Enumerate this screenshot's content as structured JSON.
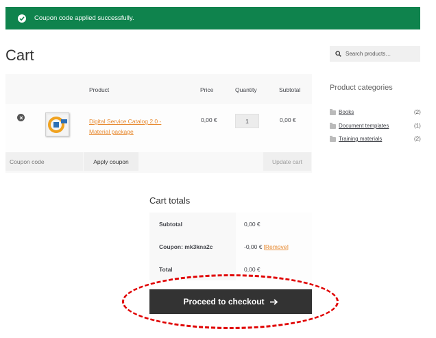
{
  "notice": {
    "message": "Coupon code applied successfully.",
    "icon": "check-icon",
    "color": "#0f834d"
  },
  "page": {
    "title": "Cart"
  },
  "cart": {
    "headers": {
      "product": "Product",
      "price": "Price",
      "quantity": "Quantity",
      "subtotal": "Subtotal"
    },
    "items": [
      {
        "name_line1": "Digital Service Catalog 2.0 -",
        "name_line2": "Material package",
        "price": "0,00 €",
        "quantity": "1",
        "subtotal": "0,00 €"
      }
    ],
    "coupon_placeholder": "Coupon code",
    "apply_label": "Apply coupon",
    "update_label": "Update cart"
  },
  "totals": {
    "title": "Cart totals",
    "subtotal_label": "Subtotal",
    "subtotal_value": "0,00 €",
    "coupon_label": "Coupon: mk3kna2c",
    "coupon_value": "-0,00 €",
    "coupon_remove": "[Remove]",
    "total_label": "Total",
    "total_value": "0,00 €",
    "checkout_label": "Proceed to checkout"
  },
  "sidebar": {
    "search_placeholder": "Search products…",
    "categories_title": "Product categories",
    "categories": [
      {
        "label": "Books",
        "count": "(2)"
      },
      {
        "label": "Document templates",
        "count": "(1)"
      },
      {
        "label": "Training materials",
        "count": "(2)"
      }
    ]
  },
  "colors": {
    "accent_link": "#e7882e",
    "button_dark": "#333333",
    "highlight": "#e00000"
  }
}
